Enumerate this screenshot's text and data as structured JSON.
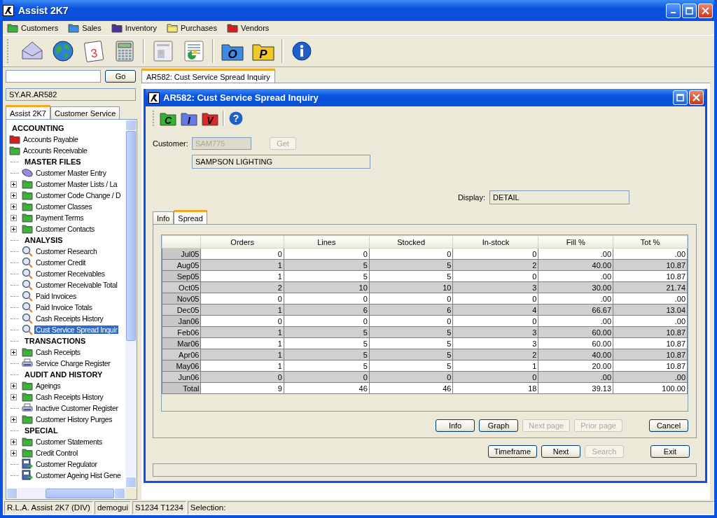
{
  "window": {
    "title": "Assist 2K7"
  },
  "menu": [
    {
      "label": "Customers",
      "color": "#3cb43c"
    },
    {
      "label": "Sales",
      "color": "#3c8ce6"
    },
    {
      "label": "Inventory",
      "color": "#46329b"
    },
    {
      "label": "Purchases",
      "color": "#f0e678"
    },
    {
      "label": "Vendors",
      "color": "#d21e1e"
    }
  ],
  "toolbar": [
    {
      "kind": "mail"
    },
    {
      "kind": "globe"
    },
    {
      "kind": "calendar",
      "label": "3"
    },
    {
      "kind": "calculator"
    },
    {
      "kind": "separator"
    },
    {
      "kind": "card"
    },
    {
      "kind": "sheet"
    },
    {
      "kind": "separator"
    },
    {
      "kind": "folder",
      "label": "O",
      "color": "#3c8ce6"
    },
    {
      "kind": "folder",
      "label": "P",
      "color": "#f0c828"
    },
    {
      "kind": "separator"
    },
    {
      "kind": "info"
    }
  ],
  "sidebar": {
    "search": {
      "button": "Go"
    },
    "path": "SY.AR.AR582",
    "tabs": [
      {
        "label": "Assist 2K7",
        "selected": true
      },
      {
        "label": "Customer Service",
        "selected": false
      }
    ],
    "tree": [
      {
        "label": "ACCOUNTING",
        "kind": "header",
        "selected": false
      },
      {
        "label": "Accounts Payable",
        "kind": "folder",
        "color": "#d21e1e",
        "selected": false
      },
      {
        "label": "Accounts Receivable",
        "kind": "folder",
        "color": "#3cb43c",
        "selected": false,
        "children": [
          {
            "label": "MASTER FILES",
            "kind": "header",
            "selected": false
          },
          {
            "label": "Customer Master Entry",
            "kind": "puck",
            "selected": false
          },
          {
            "label": "Customer Master Lists / La",
            "kind": "folder",
            "color": "#3cb43c",
            "expanded": false,
            "selected": false
          },
          {
            "label": "Customer Code Change / D",
            "kind": "folder",
            "color": "#3cb43c",
            "expanded": false,
            "selected": false
          },
          {
            "label": "Customer Classes",
            "kind": "folder",
            "color": "#3cb43c",
            "expanded": false,
            "selected": false
          },
          {
            "label": "Payment Terms",
            "kind": "folder",
            "color": "#3cb43c",
            "expanded": false,
            "selected": false
          },
          {
            "label": "Customer Contacts",
            "kind": "folder",
            "color": "#3cb43c",
            "expanded": false,
            "selected": false
          },
          {
            "label": "ANALYSIS",
            "kind": "header",
            "selected": false
          },
          {
            "label": "Customer Research",
            "kind": "search",
            "selected": false
          },
          {
            "label": "Customer Credit",
            "kind": "search",
            "selected": false
          },
          {
            "label": "Customer Receivables",
            "kind": "search",
            "selected": false
          },
          {
            "label": "Customer Receivable Total",
            "kind": "search",
            "selected": false
          },
          {
            "label": "Paid Invoices",
            "kind": "search",
            "selected": false
          },
          {
            "label": "Paid Invoice Totals",
            "kind": "search",
            "selected": false
          },
          {
            "label": "Cash Receipts History",
            "kind": "search",
            "selected": false
          },
          {
            "label": "Cust Service Spread Inquir",
            "kind": "search",
            "selected": true
          },
          {
            "label": "TRANSACTIONS",
            "kind": "header",
            "selected": false
          },
          {
            "label": "Cash Receipts",
            "kind": "folder",
            "color": "#3cb43c",
            "expanded": false,
            "selected": false
          },
          {
            "label": "Service Charge Register",
            "kind": "printer",
            "selected": false
          },
          {
            "label": "AUDIT AND HISTORY",
            "kind": "header",
            "selected": false
          },
          {
            "label": "Ageings",
            "kind": "folder",
            "color": "#3cb43c",
            "expanded": false,
            "selected": false
          },
          {
            "label": "Cash Receipts History",
            "kind": "folder",
            "color": "#3cb43c",
            "expanded": false,
            "selected": false
          },
          {
            "label": "Inactive Customer Register",
            "kind": "printer",
            "selected": false
          },
          {
            "label": "Customer History Purges",
            "kind": "folder",
            "color": "#3cb43c",
            "expanded": false,
            "selected": false
          },
          {
            "label": "SPECIAL",
            "kind": "header",
            "selected": false
          },
          {
            "label": "Customer Statements",
            "kind": "folder",
            "color": "#3cb43c",
            "expanded": false,
            "selected": false
          },
          {
            "label": "Credit Control",
            "kind": "folder",
            "color": "#3cb43c",
            "expanded": false,
            "selected": false
          },
          {
            "label": "Customer Regulator",
            "kind": "tool",
            "selected": false
          },
          {
            "label": "Customer Ageing Hist Gene",
            "kind": "tool",
            "selected": false
          }
        ]
      }
    ]
  },
  "doc_tab": {
    "label": "AR582: Cust Service Spread Inquiry"
  },
  "dialog": {
    "title": "AR582: Cust Service Spread Inquiry",
    "toolbar": [
      {
        "kind": "folder",
        "label": "C",
        "color": "#32b432"
      },
      {
        "kind": "folder",
        "label": "I",
        "color": "#6478e6"
      },
      {
        "kind": "folder",
        "label": "V",
        "color": "#dc2828"
      },
      {
        "kind": "separator"
      },
      {
        "kind": "help",
        "label": "?"
      }
    ],
    "customer": {
      "label": "Customer:",
      "value": "SAM775",
      "disabled": true,
      "button": "Get",
      "button_disabled": true,
      "name": "SAMPSON LIGHTING"
    },
    "display": {
      "label": "Display:",
      "value": "DETAIL"
    },
    "tabs": [
      {
        "label": "Info",
        "selected": false
      },
      {
        "label": "Spread",
        "selected": true
      }
    ],
    "table": {
      "columns": [
        "Orders",
        "Lines",
        "Stocked",
        "In-stock",
        "Fill %",
        "Tot %"
      ],
      "rows": [
        {
          "label": "Jul05",
          "cells": [
            "0",
            "0",
            "0",
            "0",
            ".00",
            ".00"
          ]
        },
        {
          "label": "Aug05",
          "cells": [
            "1",
            "5",
            "5",
            "2",
            "40.00",
            "10.87"
          ]
        },
        {
          "label": "Sep05",
          "cells": [
            "1",
            "5",
            "5",
            "0",
            ".00",
            "10.87"
          ]
        },
        {
          "label": "Oct05",
          "cells": [
            "2",
            "10",
            "10",
            "3",
            "30.00",
            "21.74"
          ]
        },
        {
          "label": "Nov05",
          "cells": [
            "0",
            "0",
            "0",
            "0",
            ".00",
            ".00"
          ]
        },
        {
          "label": "Dec05",
          "cells": [
            "1",
            "6",
            "6",
            "4",
            "66.67",
            "13.04"
          ]
        },
        {
          "label": "Jan06",
          "cells": [
            "0",
            "0",
            "0",
            "0",
            ".00",
            ".00"
          ]
        },
        {
          "label": "Feb06",
          "cells": [
            "1",
            "5",
            "5",
            "3",
            "60.00",
            "10.87"
          ]
        },
        {
          "label": "Mar06",
          "cells": [
            "1",
            "5",
            "5",
            "3",
            "60.00",
            "10.87"
          ]
        },
        {
          "label": "Apr06",
          "cells": [
            "1",
            "5",
            "5",
            "2",
            "40.00",
            "10.87"
          ]
        },
        {
          "label": "May06",
          "cells": [
            "1",
            "5",
            "5",
            "1",
            "20.00",
            "10.87"
          ]
        },
        {
          "label": "Jun06",
          "cells": [
            "0",
            "0",
            "0",
            "0",
            ".00",
            ".00"
          ]
        },
        {
          "label": "Total",
          "cells": [
            "9",
            "46",
            "46",
            "18",
            "39.13",
            "100.00"
          ]
        }
      ]
    },
    "panel_buttons": [
      {
        "label": "Info",
        "disabled": false
      },
      {
        "label": "Graph",
        "disabled": false
      },
      {
        "label": "Next page",
        "disabled": true
      },
      {
        "label": "Prior page",
        "disabled": true
      },
      {
        "label": "Cancel",
        "disabled": false
      }
    ],
    "buttons": [
      {
        "label": "Timeframe",
        "disabled": false
      },
      {
        "label": "Next",
        "disabled": false
      },
      {
        "label": "Search",
        "disabled": true
      },
      {
        "label": "Exit",
        "disabled": false
      }
    ]
  },
  "status_bar": [
    "R.L.A. Assist 2K7 (DIV)",
    "demogui",
    "S1234 T1234",
    "Selection:"
  ]
}
